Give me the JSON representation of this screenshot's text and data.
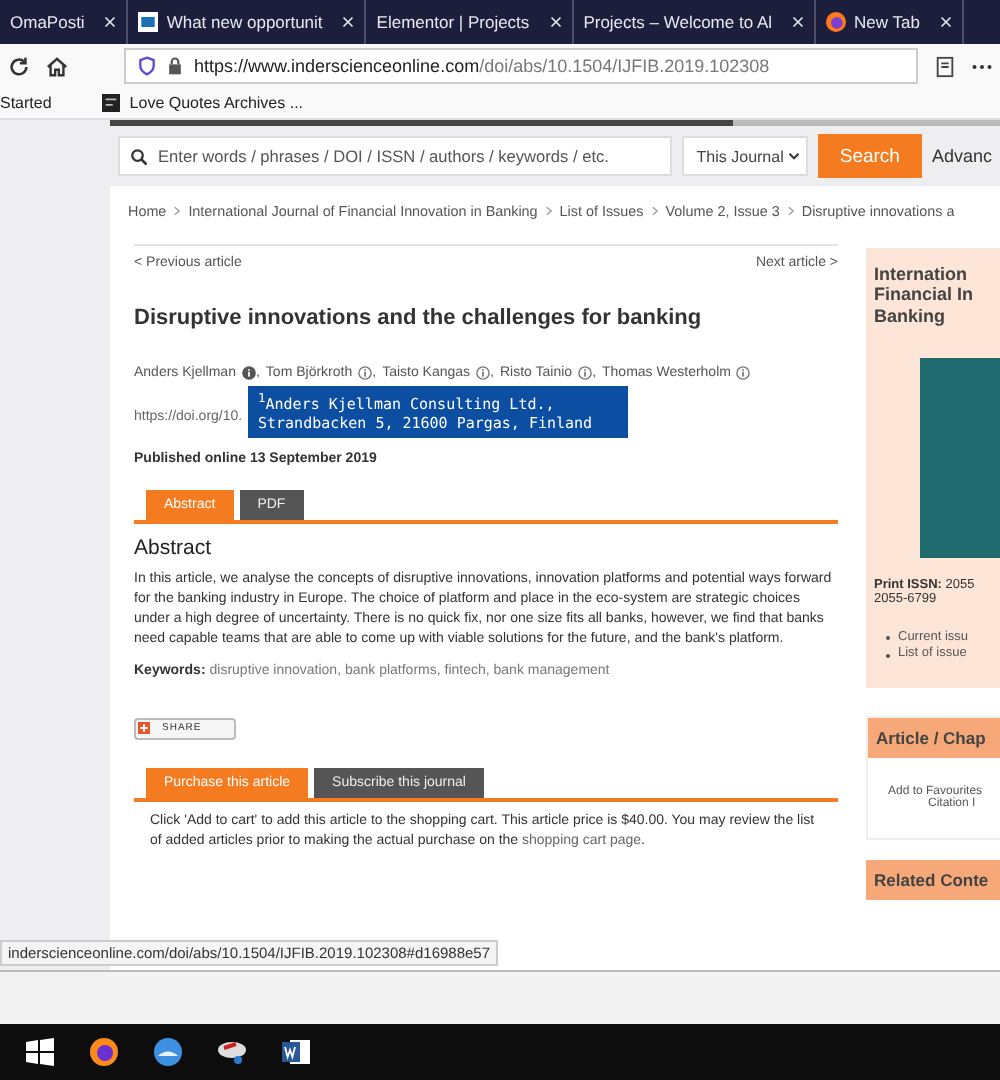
{
  "browser_tabs": [
    {
      "label": "OmaPosti",
      "kind": "plain"
    },
    {
      "label": "What new opportunit",
      "kind": "window"
    },
    {
      "label": "Elementor | Projects",
      "kind": "plain"
    },
    {
      "label": "Projects – Welcome to Al",
      "kind": "plain"
    },
    {
      "label": "New Tab",
      "kind": "firefox"
    }
  ],
  "address_bar": {
    "url_host": "https://www.inderscienceonline.com",
    "url_path": "/doi/abs/10.1504/IJFIB.2019.102308"
  },
  "bookmarks": [
    "Started",
    "Love Quotes Archives ..."
  ],
  "site_search": {
    "placeholder": "Enter words / phrases / DOI / ISSN / authors / keywords / etc.",
    "scope": "This Journal",
    "button": "Search",
    "advanced": "Advanc"
  },
  "breadcrumb": [
    "Home",
    "International Journal of Financial Innovation in Banking",
    "List of Issues",
    "Volume 2, Issue 3",
    "Disruptive innovations a"
  ],
  "article_nav": {
    "previous": "< Previous article",
    "next": "Next article >"
  },
  "title": "Disruptive innovations and the challenges for banking",
  "authors": [
    {
      "name": "Anders Kjellman",
      "active": true,
      "separator": ","
    },
    {
      "name": "Tom Björkroth",
      "active": false,
      "separator": ","
    },
    {
      "name": "Taisto Kangas",
      "active": false,
      "separator": ","
    },
    {
      "name": "Risto Tainio",
      "active": false,
      "separator": ","
    },
    {
      "name": "Thomas Westerholm",
      "active": false
    }
  ],
  "doi": "https://doi.org/10.",
  "affiliation_tooltip": [
    "$^{1}$Anders Kjellman Consulting Ltd.,",
    "Strandbacken 5, 21600 Pargas, Finland"
  ],
  "published": "Published online 13 September 2019",
  "content_tabs": [
    {
      "label": "Abstract",
      "selected": true
    },
    {
      "label": "PDF",
      "selected": false
    }
  ],
  "abstract": {
    "heading": "Abstract",
    "text": "In this article, we analyse the concepts of disruptive innovations, innovation platforms and potential ways forward for the banking industry in Europe. The choice of platform and place in the eco-system are strategic choices under a high degree of uncertainty. There is no quick fix, nor one size fits all banks, however, we find that banks need capable teams that are able to come up with viable solutions for the future, and the bank's platform.",
    "keywords_label": "Keywords:",
    "keywords": "disruptive innovation, bank platforms, fintech, bank management"
  },
  "share": "SHARE",
  "purchase_tabs": [
    {
      "label": "Purchase this article",
      "selected": true
    },
    {
      "label": "Subscribe this journal",
      "selected": false
    }
  ],
  "purchase": {
    "text": "Click 'Add to cart' to add this article to the shopping cart. This article price is $40.00. You may review the list of added articles prior to making the actual purchase on the",
    "link": "shopping cart page",
    "end": "."
  },
  "sidebar": {
    "journal_title": [
      "Internation",
      "Financial In",
      "Banking"
    ],
    "issn_label": "Print ISSN:",
    "issn": "2055",
    "issn_2": "2055-6799",
    "links": [
      "Current issu",
      "List of issue"
    ],
    "article_box_title": "Article / Chap",
    "article_box_lines": [
      "Add to Favourites",
      "Citation I"
    ],
    "related_title": "Related Conte"
  },
  "status_url": "inderscienceonline.com/doi/abs/10.1504/IJFIB.2019.102308#d16988e57",
  "taskbar": [
    {
      "kind": "start"
    },
    {
      "kind": "firefox"
    },
    {
      "kind": "mail"
    },
    {
      "kind": "app"
    },
    {
      "kind": "word"
    }
  ]
}
